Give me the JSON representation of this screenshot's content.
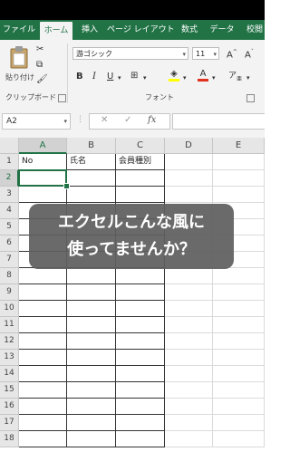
{
  "ribbon_tabs": [
    "ファイル",
    "ホーム",
    "挿入",
    "ページ レイアウト",
    "数式",
    "データ",
    "校閲"
  ],
  "active_tab": "ホーム",
  "clipboard": {
    "paste_label": "貼り付け",
    "group_label": "クリップボード"
  },
  "font": {
    "name": "游ゴシック",
    "size": "11",
    "group_label": "フォント"
  },
  "formula_bar": {
    "name_box": "A2",
    "cancel_symbol": "✕",
    "enter_symbol": "✓",
    "fx_label": "fx",
    "value": ""
  },
  "columns": [
    "A",
    "B",
    "C",
    "D",
    "E"
  ],
  "rows": [
    "1",
    "2",
    "3",
    "4",
    "5",
    "6",
    "7",
    "8",
    "9",
    "10",
    "11",
    "12",
    "13",
    "14",
    "15",
    "16",
    "17",
    "18"
  ],
  "cells": {
    "A1": "No",
    "B1": "氏名",
    "C1": "会員種別"
  },
  "selected_cell": "A2",
  "overlay_caption": [
    "エクセルこんな風に",
    "使ってませんか？"
  ],
  "colors": {
    "excel_green": "#217346",
    "ribbon_bg": "#f3f3f3",
    "overlay_bg": "#5f5f5f"
  }
}
